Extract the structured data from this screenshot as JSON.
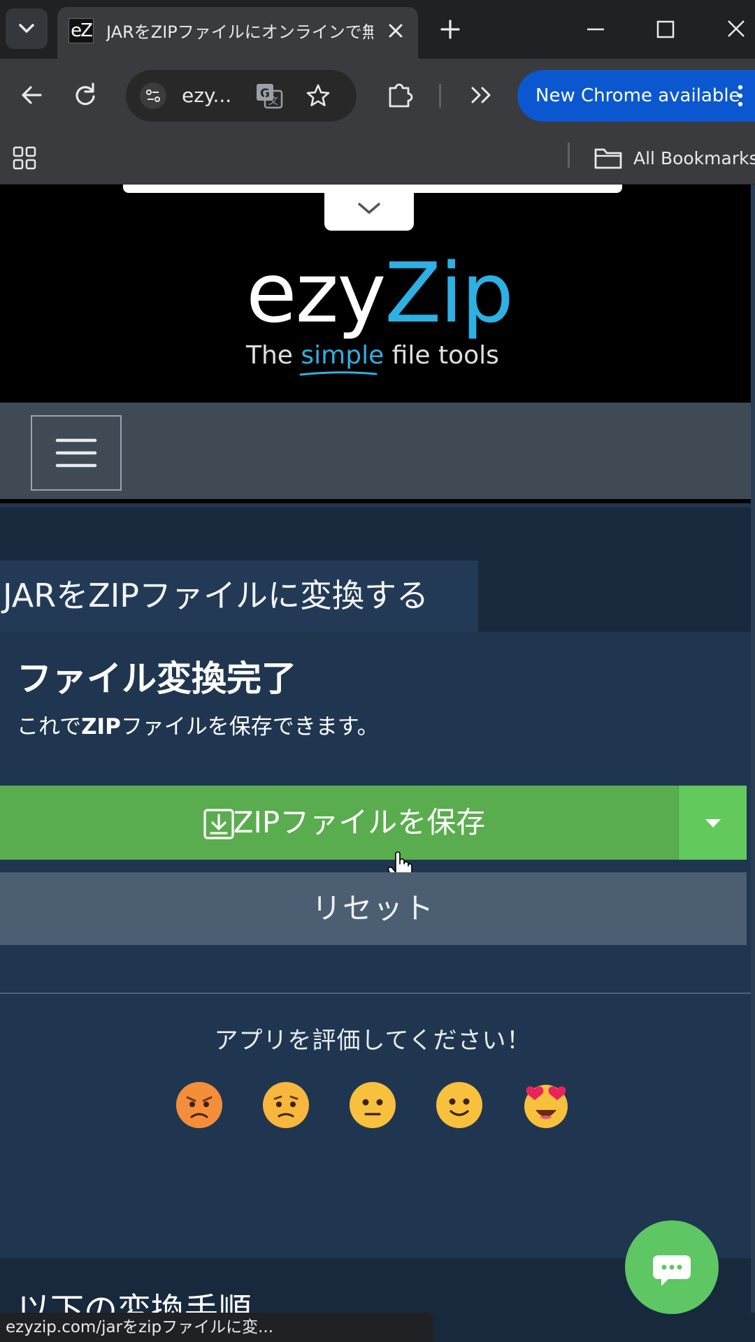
{
  "browser": {
    "tab_title": "JARをZIPファイルにオンラインで無料",
    "favicon_text": "eZ",
    "omnibox_text": "ezy...",
    "update_button_label": "New Chrome available",
    "bookmarks_label": "All Bookmarks",
    "status_url": "ezyzip.com/jarをzipファイルに変..."
  },
  "logo": {
    "brand_part1": "ezy",
    "brand_part2": "Zip",
    "tagline_pre": "The ",
    "tagline_highlight": "simple",
    "tagline_post": " file tools"
  },
  "main": {
    "page_title": "JARをZIPファイルに変換する",
    "done_heading": "ファイル変換完了",
    "done_subtext_pre": "これで",
    "done_subtext_bold": "ZIP",
    "done_subtext_post": "ファイルを保存できます。",
    "save_button": "ZIPファイルを保存",
    "reset_button": "リセット",
    "rating_prompt": "アプリを評価してください！",
    "ratings": [
      "angry",
      "sad",
      "neutral",
      "smile",
      "heart-eyes"
    ],
    "next_section_heading": "以下の変換手順"
  },
  "colors": {
    "brand_blue": "#2eb0e2",
    "save_green": "#5aad4e",
    "chat_green": "#5fc664",
    "page_bg": "#203650"
  }
}
